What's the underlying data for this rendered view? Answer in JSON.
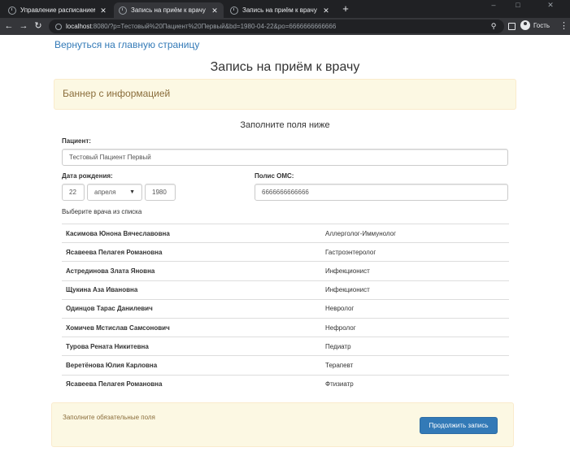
{
  "browser": {
    "tabs": [
      {
        "title": "Управление расписанием",
        "active": false
      },
      {
        "title": "Запись на приём к врачу",
        "active": true
      },
      {
        "title": "Запись на приём к врачу",
        "active": false
      }
    ],
    "new_tab_label": "+",
    "url_host": "localhost",
    "url_rest": ":8080/?p=Тестовый%20Пациент%20Первый&bd=1980-04-22&po=6666666666666",
    "profile_name": "Гость",
    "window_controls": [
      "–",
      "□",
      "✕"
    ]
  },
  "page": {
    "back_link": "Вернуться на главную страницу",
    "title": "Запись на приём к врачу",
    "info_banner": "Баннер с информацией",
    "form_subtitle": "Заполните поля ниже",
    "patient_label": "Пациент:",
    "patient_value": "Тестовый Пациент Первый",
    "birthdate_label": "Дата рождения:",
    "birth_day": "22",
    "birth_month": "апреля",
    "birth_year": "1980",
    "policy_label": "Полис ОМС:",
    "policy_value": "6666666666666",
    "doctor_hint": "Выберите врача из списка",
    "doctors": [
      {
        "name": "Касимова Юнона Вячеславовна",
        "specialty": "Аллерголог-Иммунолог"
      },
      {
        "name": "Ясавеева Пелагея Романовна",
        "specialty": "Гастроэнтеролог"
      },
      {
        "name": "Астрединова Злата Яновна",
        "specialty": "Инфекционист"
      },
      {
        "name": "Щукина Аза Ивановна",
        "specialty": "Инфекционист"
      },
      {
        "name": "Одинцов Тарас Данилевич",
        "specialty": "Невролог"
      },
      {
        "name": "Хомичев Мстислав Самсонович",
        "specialty": "Нефролог"
      },
      {
        "name": "Турова Рената Никитевна",
        "specialty": "Педиатр"
      },
      {
        "name": "Веретёнова Юлия Карловна",
        "specialty": "Терапевт"
      },
      {
        "name": "Ясавеева Пелагея Романовна",
        "specialty": "Фтизиатр"
      }
    ],
    "footer_message": "Заполните обязательные поля",
    "continue_button": "Продолжить запись"
  },
  "colors": {
    "link": "#337ab7",
    "warning_bg": "#fcf8e3",
    "warning_text": "#8a6d3b",
    "primary_button": "#337ab7"
  }
}
